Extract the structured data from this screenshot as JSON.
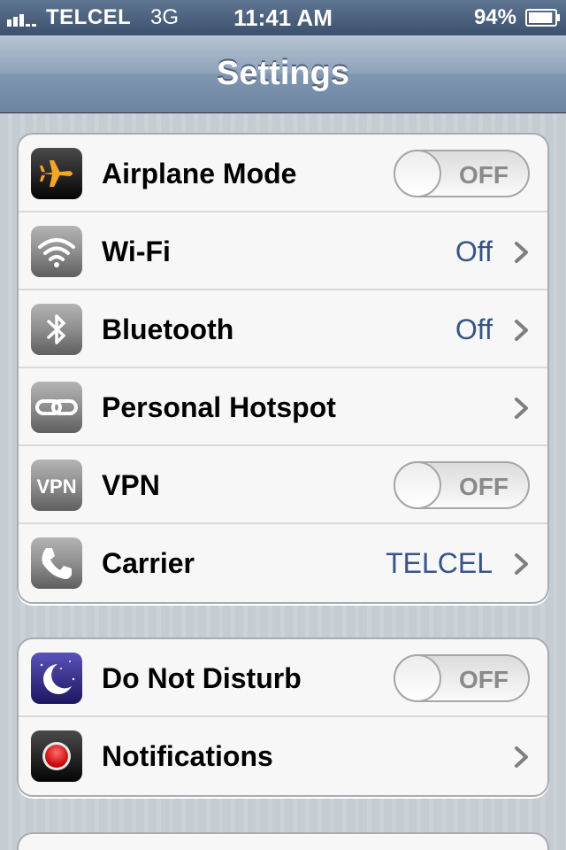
{
  "status_bar": {
    "carrier": "TELCEL",
    "network": "3G",
    "time": "11:41 AM",
    "battery_percent": "94%",
    "battery_level": 0.94,
    "signal_bars": 3,
    "text_color": "#ffffff"
  },
  "nav": {
    "title": "Settings"
  },
  "colors": {
    "value_text": "#385487",
    "group_background": "#f7f7f7",
    "page_background": "#c5ccd4"
  },
  "groups": [
    {
      "rows": [
        {
          "label": "Airplane Mode",
          "icon": "airplane-icon",
          "toggle": "OFF"
        },
        {
          "label": "Wi-Fi",
          "icon": "wifi-icon",
          "value": "Off"
        },
        {
          "label": "Bluetooth",
          "icon": "bluetooth-icon",
          "value": "Off"
        },
        {
          "label": "Personal Hotspot",
          "icon": "hotspot-icon"
        },
        {
          "label": "VPN",
          "icon": "vpn-icon",
          "icon_text": "VPN",
          "toggle": "OFF"
        },
        {
          "label": "Carrier",
          "icon": "phone-icon",
          "value": "TELCEL"
        }
      ]
    },
    {
      "rows": [
        {
          "label": "Do Not Disturb",
          "icon": "moon-icon",
          "toggle": "OFF"
        },
        {
          "label": "Notifications",
          "icon": "notifications-icon"
        }
      ]
    }
  ]
}
